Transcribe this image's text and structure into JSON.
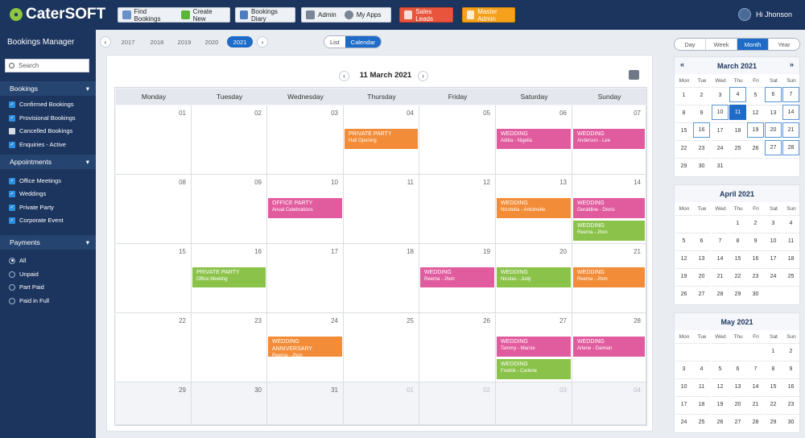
{
  "app": {
    "brand": "CaterSOFT",
    "greeting": "Hi Jhonson"
  },
  "toolbar": {
    "find": "Find Bookings",
    "create": "Create New",
    "diary": "Bookings Diary",
    "admin": "Admin",
    "apps": "My Apps",
    "sales": "Sales Leads",
    "master": "Master Admin"
  },
  "sidebar": {
    "title": "Bookings Manager",
    "search": "Search",
    "bookings_head": "Bookings",
    "bookings": [
      {
        "label": "Confirmed Bookings",
        "checked": true
      },
      {
        "label": "Provisional Bookings",
        "checked": true
      },
      {
        "label": "Cancelled Bookings",
        "checked": false
      },
      {
        "label": "Enquiries - Active",
        "checked": true
      }
    ],
    "appointments_head": "Appointments",
    "appointments": [
      {
        "label": "Office Meetings"
      },
      {
        "label": "Weddings"
      },
      {
        "label": "Private Party"
      },
      {
        "label": "Corporate Event"
      }
    ],
    "payments_head": "Payments",
    "payments": [
      {
        "label": "All"
      },
      {
        "label": "Unpaid"
      },
      {
        "label": "Part Paid"
      },
      {
        "label": "Paid in Full"
      }
    ]
  },
  "years": [
    "2017",
    "2018",
    "2019",
    "2020",
    "2021"
  ],
  "selected_year": "2021",
  "view_toggle": {
    "list": "List",
    "calendar": "Calendar"
  },
  "calendar": {
    "date_label": "11 March 2021",
    "weekdays": [
      "Monday",
      "Tuesday",
      "Wednesday",
      "Thursday",
      "Friday",
      "Saturday",
      "Sunday"
    ],
    "weeks": [
      [
        "01",
        "02",
        "03",
        "04",
        "05",
        "06",
        "07"
      ],
      [
        "08",
        "09",
        "10",
        "11",
        "12",
        "13",
        "14"
      ],
      [
        "15",
        "16",
        "17",
        "18",
        "19",
        "20",
        "21"
      ],
      [
        "22",
        "23",
        "24",
        "25",
        "26",
        "27",
        "28"
      ],
      [
        "29",
        "30",
        "31",
        "01",
        "02",
        "03",
        "04"
      ]
    ],
    "events": [
      {
        "row": 0,
        "col": 3,
        "slot": 0,
        "title": "PRIVATE PARTY",
        "sub": "Hall Opening",
        "color": "orange"
      },
      {
        "row": 0,
        "col": 5,
        "slot": 0,
        "title": "WEDDING",
        "sub": "Adiba  - Nigella",
        "color": "pink"
      },
      {
        "row": 0,
        "col": 6,
        "slot": 0,
        "title": "WEDDING",
        "sub": "Anderson - Lee",
        "color": "pink"
      },
      {
        "row": 1,
        "col": 2,
        "slot": 0,
        "title": "OFFICE PARTY",
        "sub": "Anual Celebrations",
        "color": "pink"
      },
      {
        "row": 1,
        "col": 5,
        "slot": 0,
        "title": "WEDDING",
        "sub": "Nicoletta - Antoinette",
        "color": "orange"
      },
      {
        "row": 1,
        "col": 6,
        "slot": 0,
        "title": "WEDDING",
        "sub": "Geraldine - Denis",
        "color": "pink"
      },
      {
        "row": 1,
        "col": 6,
        "slot": 1,
        "title": "WEDDING",
        "sub": "Reema - Jhon",
        "color": "green"
      },
      {
        "row": 2,
        "col": 1,
        "slot": 0,
        "title": "PRIVATE PARTY",
        "sub": "Office Meeting",
        "color": "green"
      },
      {
        "row": 2,
        "col": 4,
        "slot": 0,
        "title": "WEDDING",
        "sub": "Reema - Jhon",
        "color": "pink"
      },
      {
        "row": 2,
        "col": 5,
        "slot": 0,
        "title": "WEDDING",
        "sub": "Nicolas - Judy",
        "color": "green"
      },
      {
        "row": 2,
        "col": 6,
        "slot": 0,
        "title": "WEDDING",
        "sub": "Reema - Jhon",
        "color": "orange"
      },
      {
        "row": 3,
        "col": 2,
        "slot": 0,
        "title": "WEDDING ANNIVERSARY",
        "sub": "Reema - Jhon",
        "color": "orange"
      },
      {
        "row": 3,
        "col": 5,
        "slot": 0,
        "title": "WEDDING",
        "sub": "Tammy - Marcie",
        "color": "pink"
      },
      {
        "row": 3,
        "col": 5,
        "slot": 1,
        "title": "WEDDING",
        "sub": "Fredrik - Carlene",
        "color": "green"
      },
      {
        "row": 3,
        "col": 6,
        "slot": 0,
        "title": "WEDDING",
        "sub": "Arlene - Damian",
        "color": "pink"
      }
    ]
  },
  "view_buttons": [
    "Day",
    "Week",
    "Month",
    "Year"
  ],
  "selected_view": "Month",
  "mini_weekdays": [
    "Mon",
    "Tue",
    "Wed",
    "Thu",
    "Fri",
    "Sat",
    "Sun"
  ],
  "mini_calendars": [
    {
      "title": "March 2021",
      "nav": true,
      "rows": [
        [
          "1",
          "2",
          "3",
          "4",
          "5",
          "6",
          "7"
        ],
        [
          "8",
          "9",
          "10",
          "11",
          "12",
          "13",
          "14"
        ],
        [
          "15",
          "16",
          "17",
          "18",
          "19",
          "20",
          "21"
        ],
        [
          "22",
          "23",
          "24",
          "25",
          "26",
          "27",
          "28"
        ],
        [
          "29",
          "30",
          "31",
          "",
          "",
          "",
          ""
        ]
      ],
      "outlined": [
        "4",
        "6",
        "7",
        "10",
        "14",
        "16",
        "19",
        "20",
        "21",
        "27",
        "28"
      ],
      "selected": "11"
    },
    {
      "title": "April 2021",
      "nav": false,
      "rows": [
        [
          "",
          "",
          "",
          "1",
          "2",
          "3",
          "4"
        ],
        [
          "5",
          "6",
          "7",
          "8",
          "9",
          "10",
          "11"
        ],
        [
          "12",
          "13",
          "14",
          "15",
          "16",
          "17",
          "18"
        ],
        [
          "19",
          "20",
          "21",
          "22",
          "23",
          "24",
          "25"
        ],
        [
          "26",
          "27",
          "28",
          "29",
          "30",
          "",
          ""
        ]
      ],
      "outlined": [],
      "selected": ""
    },
    {
      "title": "May 2021",
      "nav": false,
      "rows": [
        [
          "",
          "",
          "",
          "",
          "",
          "1",
          "2"
        ],
        [
          "3",
          "4",
          "5",
          "6",
          "7",
          "8",
          "9"
        ],
        [
          "10",
          "11",
          "12",
          "13",
          "14",
          "15",
          "16"
        ],
        [
          "17",
          "18",
          "19",
          "20",
          "21",
          "22",
          "23"
        ],
        [
          "24",
          "25",
          "26",
          "27",
          "28",
          "29",
          "30"
        ]
      ],
      "outlined": [],
      "selected": ""
    }
  ]
}
